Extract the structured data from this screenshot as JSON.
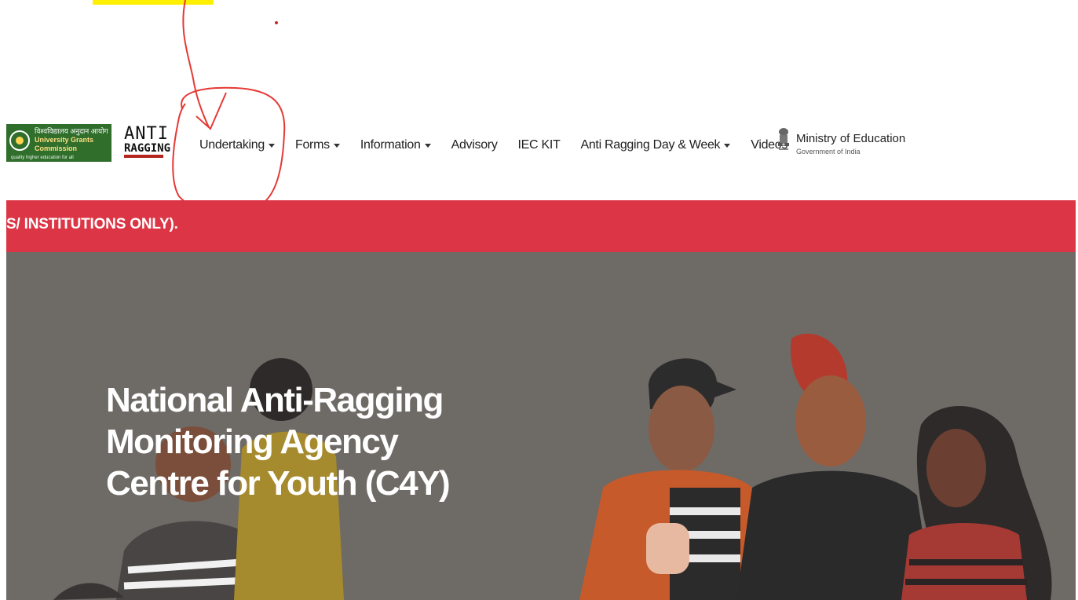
{
  "page": {
    "background": "#ffffff"
  },
  "header": {
    "ugc_logo": {
      "hindi": "विश्वविद्यालय अनुदान आयोग",
      "name": "University Grants Commission",
      "tagline": "quality higher education for all"
    },
    "anti_ragging_logo": {
      "top": "ANTI",
      "bottom": "RAGGING"
    },
    "nav_items": [
      {
        "label": "Undertaking",
        "has_caret": true
      },
      {
        "label": "Forms",
        "has_caret": true
      },
      {
        "label": "Information",
        "has_caret": true
      },
      {
        "label": "Advisory",
        "has_caret": false
      },
      {
        "label": "IEC KIT",
        "has_caret": false
      },
      {
        "label": "Anti Ragging Day & Week",
        "has_caret": true
      },
      {
        "label": "Videos",
        "has_caret": false
      }
    ],
    "ministry": {
      "title": "Ministry of Education",
      "subtitle": "Government of India"
    }
  },
  "banner": {
    "text": "S/ INSTITUTIONS ONLY).",
    "color": "#dc3545"
  },
  "hero": {
    "title_lines": [
      "National Anti-Ragging",
      "Monitoring Agency",
      "Centre for Youth (C4Y)"
    ],
    "background": "#6e6a66"
  },
  "annotation": {
    "color": "#e53935",
    "highlight_color": "#ffef00"
  }
}
